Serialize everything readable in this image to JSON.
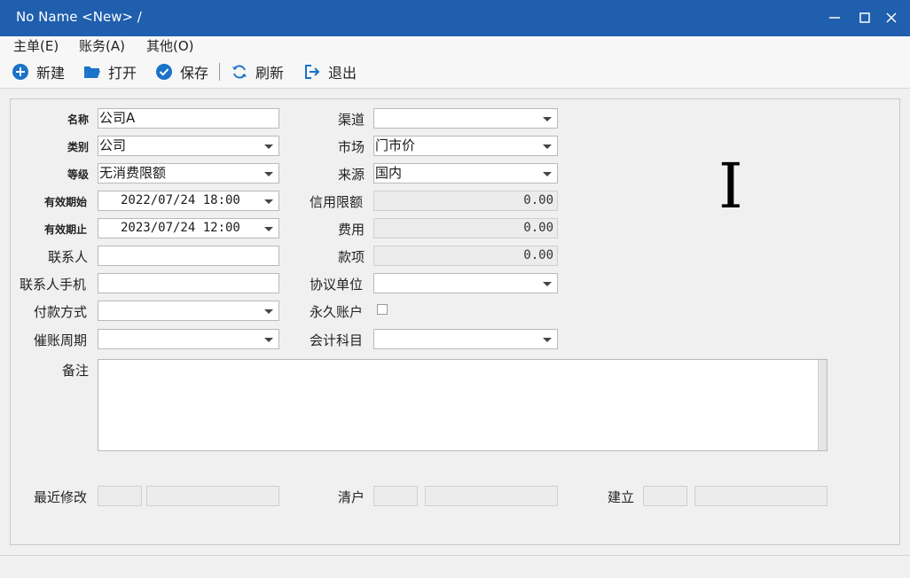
{
  "window": {
    "title": "No Name <New> /"
  },
  "menu": [
    {
      "label": "主单(E)"
    },
    {
      "label": "账务(A)"
    },
    {
      "label": "其他(O)"
    }
  ],
  "toolbar": {
    "new": "新建",
    "open": "打开",
    "save": "保存",
    "refresh": "刷新",
    "exit": "退出"
  },
  "form": {
    "name": {
      "label": "名称",
      "value": "公司A"
    },
    "category": {
      "label": "类别",
      "value": "公司"
    },
    "level": {
      "label": "等级",
      "value": "无消费限额"
    },
    "valid_start": {
      "label": "有效期始",
      "value": "2022/07/24 18:00"
    },
    "valid_end": {
      "label": "有效期止",
      "value": "2023/07/24 12:00"
    },
    "contact": {
      "label": "联系人",
      "value": ""
    },
    "contact_phone": {
      "label": "联系人手机",
      "value": ""
    },
    "payment_method": {
      "label": "付款方式",
      "value": ""
    },
    "collection_period": {
      "label": "催账周期",
      "value": ""
    },
    "channel": {
      "label": "渠道",
      "value": ""
    },
    "market": {
      "label": "市场",
      "value": "门市价"
    },
    "source": {
      "label": "来源",
      "value": "国内"
    },
    "credit_limit": {
      "label": "信用限额",
      "value": "0.00"
    },
    "fee": {
      "label": "费用",
      "value": "0.00"
    },
    "payment": {
      "label": "款项",
      "value": "0.00"
    },
    "agreement_unit": {
      "label": "协议单位",
      "value": ""
    },
    "permanent_account": {
      "label": "永久账户",
      "checked": false
    },
    "accounting_subject": {
      "label": "会计科目",
      "value": ""
    },
    "remarks": {
      "label": "备注",
      "value": ""
    },
    "last_modified": {
      "label": "最近修改"
    },
    "clear": {
      "label": "清户"
    },
    "created": {
      "label": "建立"
    }
  },
  "colors": {
    "titlebar": "#1f5fae",
    "icon_blue": "#1a73c8"
  }
}
